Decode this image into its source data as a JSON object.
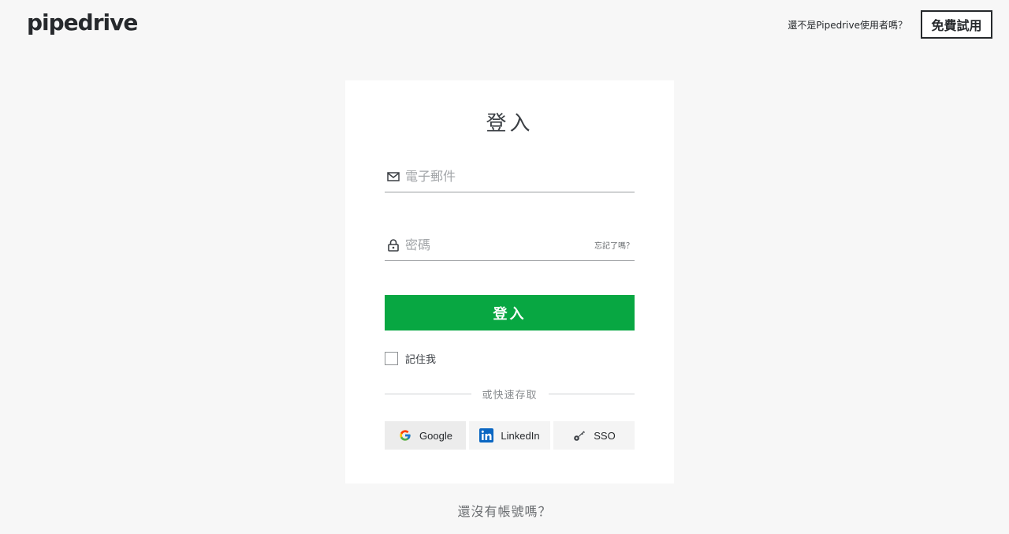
{
  "header": {
    "logo_text": "pipedrive",
    "not_user_text": "還不是Pipedrive使用者嗎？",
    "free_trial_label": "免費試用"
  },
  "login_card": {
    "title": "登入",
    "email_placeholder": "電子郵件",
    "password_placeholder": "密碼",
    "forgot_label": "忘記了嗎？",
    "login_button_label": "登入",
    "remember_label": "記住我",
    "divider_text": "或快速存取",
    "quick_access": [
      {
        "label": "Google",
        "icon": "google-icon"
      },
      {
        "label": "LinkedIn",
        "icon": "linkedin-icon"
      },
      {
        "label": "SSO",
        "icon": "key-icon"
      }
    ]
  },
  "footer": {
    "no_account_text": "還沒有帳號嗎？"
  },
  "colors": {
    "primary_green": "#08a742",
    "background": "#f7f7f7",
    "text_dark": "#26292c",
    "linkedin_blue": "#0a66c2"
  }
}
